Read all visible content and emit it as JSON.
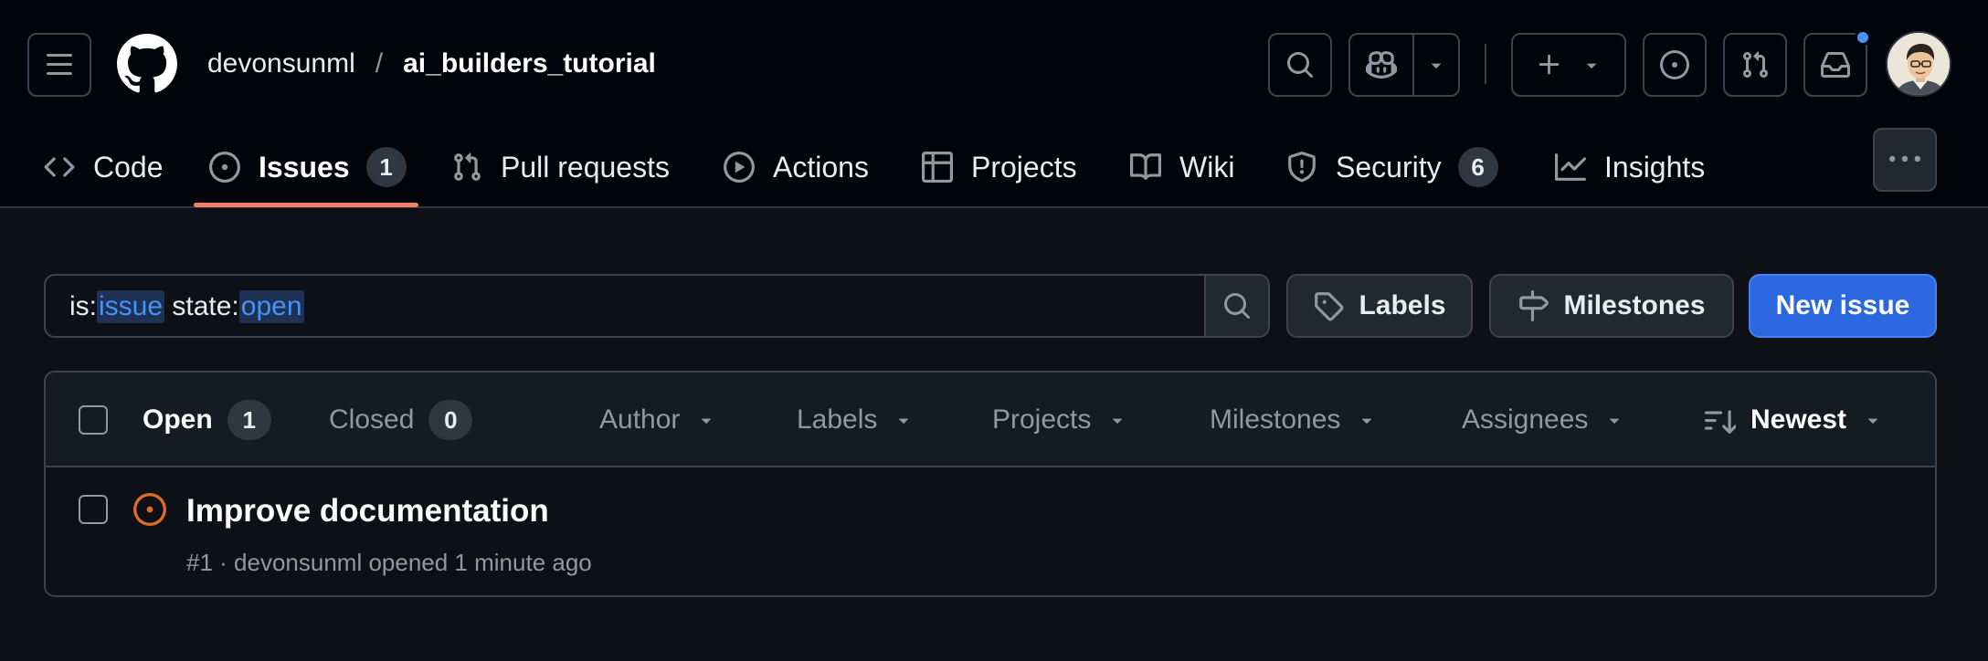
{
  "header": {
    "owner": "devonsunml",
    "separator": "/",
    "repo": "ai_builders_tutorial"
  },
  "nav": {
    "tabs": [
      {
        "label": "Code"
      },
      {
        "label": "Issues",
        "count": "1"
      },
      {
        "label": "Pull requests"
      },
      {
        "label": "Actions"
      },
      {
        "label": "Projects"
      },
      {
        "label": "Wiki"
      },
      {
        "label": "Security",
        "count": "6"
      },
      {
        "label": "Insights"
      }
    ]
  },
  "filter": {
    "query_prefix_is": "is:",
    "query_is_value": "issue",
    "query_state_key": "state:",
    "query_state_value": "open",
    "labels_button": "Labels",
    "milestones_button": "Milestones",
    "new_issue_button": "New issue"
  },
  "issues": {
    "open_label": "Open",
    "open_count": "1",
    "closed_label": "Closed",
    "closed_count": "0",
    "filters": {
      "author": "Author",
      "labels": "Labels",
      "projects": "Projects",
      "milestones": "Milestones",
      "assignees": "Assignees",
      "sort": "Newest"
    },
    "rows": [
      {
        "title": "Improve documentation",
        "meta": "#1 · devonsunml opened 1 minute ago"
      }
    ]
  },
  "colors": {
    "accent": "#f78166",
    "primary_button": "#2b67de",
    "link_blue": "#4493f8",
    "open_issue_icon": "#db6d28"
  }
}
